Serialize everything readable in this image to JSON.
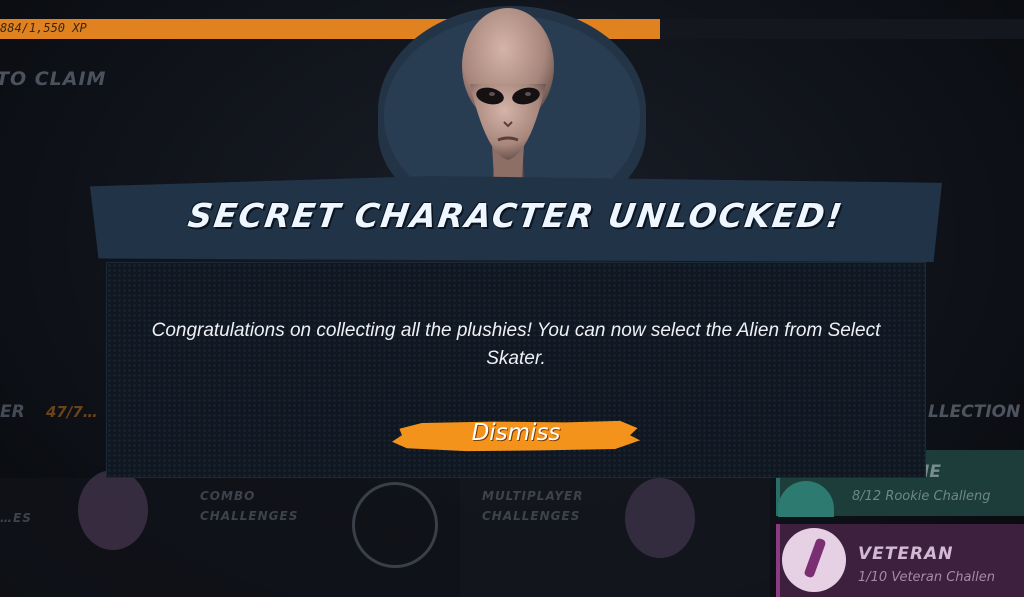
{
  "background": {
    "xp_text": "884/1,550 XP",
    "claim_text": "TO CLAIM",
    "left_label": "ER",
    "left_count": "47/7…",
    "collection_label": "LLECTION",
    "categories": [
      "…ES",
      "COMBO\nCHALLENGES",
      "MULTIPLAYER\nCHALLENGES"
    ],
    "rookie": {
      "title": "…IE",
      "subtitle": "8/12 Rookie Challeng"
    },
    "veteran": {
      "title": "VETERAN",
      "subtitle": "1/10 Veteran Challen"
    },
    "colors": {
      "xp_bar": "#e0821f",
      "rookie": "#1c3d3a",
      "veteran": "#3d1f3e"
    }
  },
  "modal": {
    "title": "SECRET CHARACTER UNLOCKED!",
    "message": "Congratulations on collecting all the plushies! You can now select the Alien from Select Skater.",
    "dismiss_label": "Dismiss",
    "character_icon": "alien-portrait",
    "colors": {
      "accent": "#f3931c",
      "panel": "#213447"
    }
  }
}
